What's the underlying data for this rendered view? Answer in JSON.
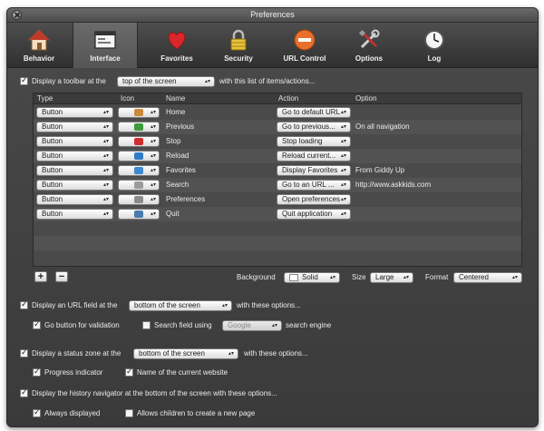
{
  "window": {
    "title": "Preferences"
  },
  "tabs": [
    {
      "label": "Behavior",
      "icon": "house-icon"
    },
    {
      "label": "Interface",
      "icon": "window-icon",
      "selected": true
    },
    {
      "label": "Favorites",
      "icon": "heart-icon"
    },
    {
      "label": "Security",
      "icon": "lock-icon"
    },
    {
      "label": "URL Control",
      "icon": "stop-sign-icon"
    },
    {
      "label": "Options",
      "icon": "tools-icon"
    },
    {
      "label": "Log",
      "icon": "clock-icon"
    }
  ],
  "toolbar_section": {
    "checkbox_label": "Display a toolbar at the",
    "position_value": "top of the screen",
    "suffix": "with this list of items/actions...",
    "checked": true
  },
  "table": {
    "headers": {
      "type": "Type",
      "icon": "Icon",
      "name": "Name",
      "action": "Action",
      "option": "Option"
    },
    "rows": [
      {
        "type": "Button",
        "icon": "home-icon",
        "name": "Home",
        "action": "Go to default URL",
        "option": ""
      },
      {
        "type": "Button",
        "icon": "back-arrow-icon",
        "name": "Previous",
        "action": "Go to previous...",
        "option": "On all navigation"
      },
      {
        "type": "Button",
        "icon": "stop-icon",
        "name": "Stop",
        "action": "Stop loading",
        "option": ""
      },
      {
        "type": "Button",
        "icon": "reload-icon",
        "name": "Reload",
        "action": "Reload current...",
        "option": ""
      },
      {
        "type": "Button",
        "icon": "favorites-icon",
        "name": "Favorites",
        "action": "Display Favorites",
        "option": "From Giddy Up"
      },
      {
        "type": "Button",
        "icon": "search-icon",
        "name": "Search",
        "action": "Go to an URL ...",
        "option": "http://www.askkids.com"
      },
      {
        "type": "Button",
        "icon": "preferences-icon",
        "name": "Preferences",
        "action": "Open preferences",
        "option": ""
      },
      {
        "type": "Button",
        "icon": "quit-icon",
        "name": "Quit",
        "action": "Quit application",
        "option": ""
      }
    ]
  },
  "table_controls": {
    "add": "+",
    "remove": "−",
    "background_label": "Background",
    "background_value": "Solid",
    "size_label": "Size",
    "size_value": "Large",
    "format_label": "Format",
    "format_value": "Centered"
  },
  "url_section": {
    "label": "Display an URL field at the",
    "position_value": "bottom of the screen",
    "suffix": "with these options...",
    "checked": true,
    "go_button_label": "Go button for validation",
    "go_checked": true,
    "search_label": "Search field using",
    "search_checked": false,
    "search_engine_value": "Google",
    "search_suffix": "search engine"
  },
  "status_section": {
    "label": "Display a status zone at the",
    "position_value": "bottom of the screen",
    "suffix": "with these options...",
    "checked": true,
    "progress_label": "Progress indicator",
    "progress_checked": true,
    "website_label": "Name of the current website",
    "website_checked": true
  },
  "history_section": {
    "label": "Display the history navigator at the bottom of the screen with these options...",
    "checked": true,
    "always_label": "Always displayed",
    "always_checked": true,
    "children_label": "Allows children to create a new page",
    "children_checked": false
  }
}
